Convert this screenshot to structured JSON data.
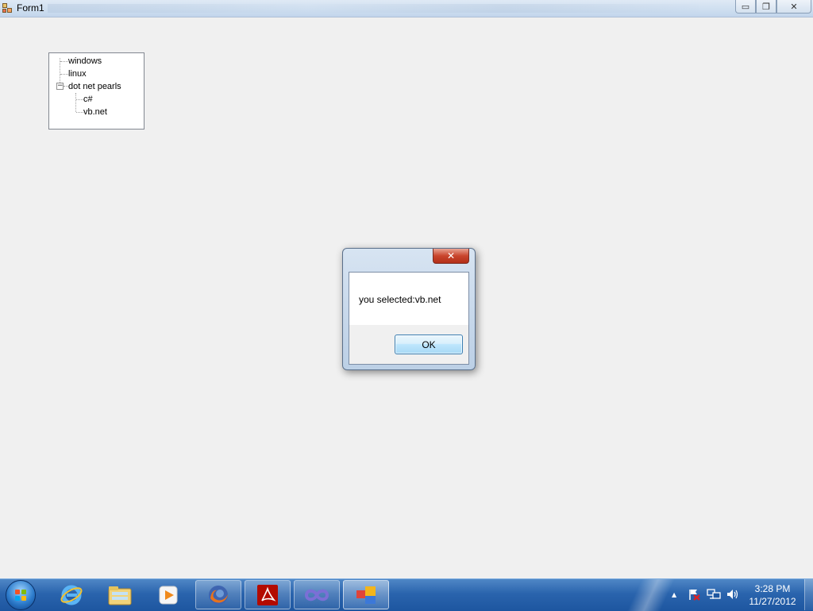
{
  "window": {
    "title": "Form1",
    "caption_buttons": {
      "minimize": "▭",
      "maximize": "❐",
      "close": "✕"
    }
  },
  "tree": {
    "nodes": [
      {
        "label": "windows",
        "level": 0
      },
      {
        "label": "linux",
        "level": 0
      },
      {
        "label": "dot net pearls",
        "level": 0,
        "expanded": true,
        "expander_glyph": "−"
      },
      {
        "label": "c#",
        "level": 1
      },
      {
        "label": "vb.net",
        "level": 1
      }
    ]
  },
  "message_box": {
    "text": "you selected:vb.net",
    "ok_label": "OK",
    "close_glyph": "✕"
  },
  "taskbar": {
    "items": [
      {
        "name": "internet-explorer-icon",
        "pinned": true
      },
      {
        "name": "windows-explorer-icon",
        "pinned": true
      },
      {
        "name": "media-player-icon",
        "pinned": true
      },
      {
        "name": "firefox-icon",
        "active": true
      },
      {
        "name": "adobe-reader-icon",
        "active": true
      },
      {
        "name": "visual-studio-icon",
        "active": true
      },
      {
        "name": "form1-app-icon",
        "active": true,
        "focused": true
      }
    ],
    "tray": {
      "show_hidden_glyph": "▲",
      "icons": [
        "action-center-icon",
        "network-icon",
        "volume-icon"
      ]
    },
    "clock": {
      "time": "3:28 PM",
      "date": "11/27/2012"
    }
  },
  "colors": {
    "desktop_bg": "#f0f0f0",
    "taskbar": "#2a64ad",
    "close_button": "#c9452d",
    "ok_button_border": "#3c7fb1"
  }
}
